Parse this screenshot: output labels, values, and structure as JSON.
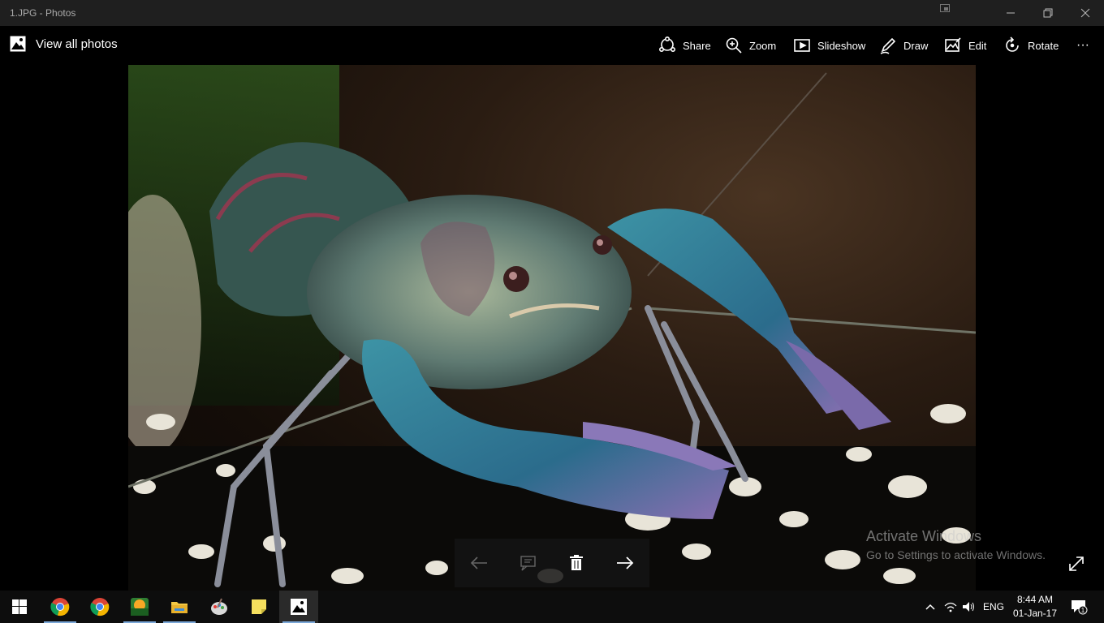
{
  "window": {
    "title": "1.JPG - Photos"
  },
  "commandbar": {
    "view_all": "View all photos",
    "share": "Share",
    "zoom": "Zoom",
    "slideshow": "Slideshow",
    "draw": "Draw",
    "edit": "Edit",
    "rotate": "Rotate",
    "more": "···"
  },
  "watermark": {
    "line1": "Activate Windows",
    "line2": "Go to Settings to activate Windows."
  },
  "taskbar": {
    "lang": "ENG",
    "time": "8:44 AM",
    "date": "01-Jan-17",
    "notifications_count": "1"
  },
  "colors": {
    "titlebar": "#1f1f1f",
    "taskbar": "#0d0d0d",
    "accent": "#7aa7d8"
  }
}
